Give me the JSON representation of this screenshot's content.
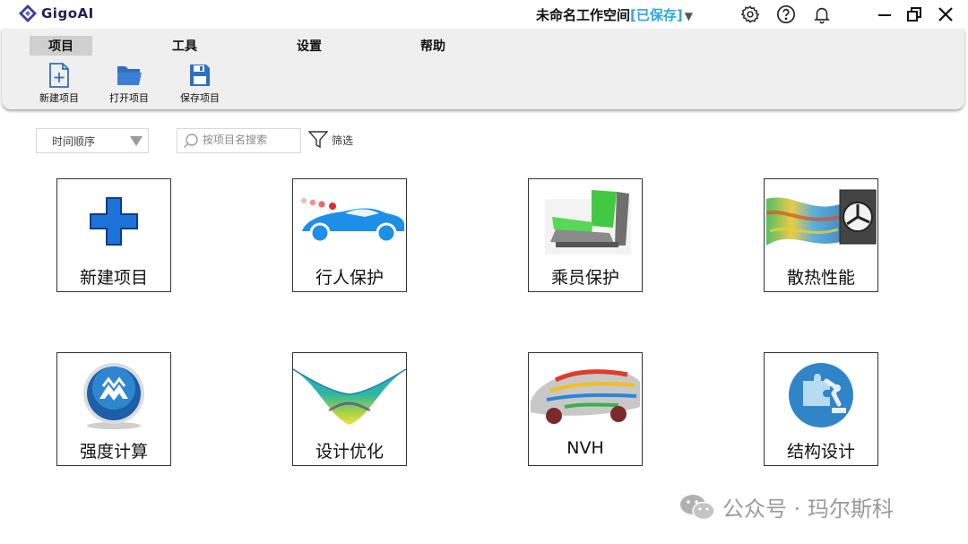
{
  "app": {
    "name": "GigoAI",
    "workspace_name": "未命名工作空间",
    "workspace_status": "[已保存]",
    "workspace_caret": "▼"
  },
  "window_controls": [
    "settings-icon",
    "help-icon",
    "bell-icon",
    "minimize-icon",
    "restore-icon",
    "close-icon"
  ],
  "menu": {
    "tabs": [
      {
        "label": "项目",
        "active": true
      },
      {
        "label": "工具",
        "active": false
      },
      {
        "label": "设置",
        "active": false
      },
      {
        "label": "帮助",
        "active": false
      }
    ]
  },
  "ribbon": {
    "buttons": [
      {
        "label": "新建项目",
        "icon": "new-file-icon"
      },
      {
        "label": "打开项目",
        "icon": "open-folder-icon"
      },
      {
        "label": "保存项目",
        "icon": "save-icon"
      }
    ]
  },
  "toolbar": {
    "sort_value": "时间顺序",
    "search_placeholder": "按项目名搜索",
    "filter_label": "筛选"
  },
  "cards": [
    {
      "label": "新建项目",
      "icon": "blue-plus-icon"
    },
    {
      "label": "行人保护",
      "icon": "car-pedestrian-image"
    },
    {
      "label": "乘员保护",
      "icon": "car-seat-image"
    },
    {
      "label": "散热性能",
      "icon": "thermal-flow-image"
    },
    {
      "label": "强度计算",
      "icon": "strength-calc-icon"
    },
    {
      "label": "设计优化",
      "icon": "optimization-surface-image"
    },
    {
      "label": "NVH",
      "icon": "nvh-car-image"
    },
    {
      "label": "结构设计",
      "icon": "robot-arm-icon"
    }
  ],
  "watermark": {
    "text": "公众号 · 玛尔斯科"
  },
  "colors": {
    "accent": "#2aa6e8",
    "brand": "#3b3f9a",
    "ribbon_bg": "#efefef",
    "plus_blue": "#1f73d8"
  }
}
